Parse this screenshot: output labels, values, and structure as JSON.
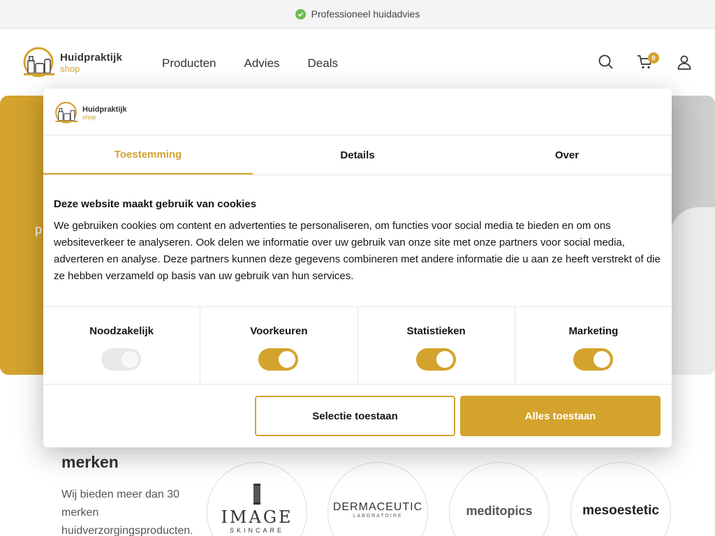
{
  "topbar": {
    "text": "Professioneel huidadvies"
  },
  "header": {
    "logo_line1": "Huidpraktijk",
    "logo_line2": "shop",
    "nav": [
      "Producten",
      "Advies",
      "Deals"
    ],
    "cart_count": "0"
  },
  "hero": {
    "partial_text": "p"
  },
  "brands": {
    "title": "merken",
    "description": "Wij bieden meer dan 30 merken huidverzorgingsproducten.",
    "items": [
      "IMAGE",
      "DERMACEUTIC",
      "meditopics",
      "mesoestetic"
    ],
    "image_sub": "SKINCARE",
    "dermaceutic_sub": "LABORATOIRE"
  },
  "cookie": {
    "logo_line1": "Huidpraktijk",
    "logo_line2": "shop",
    "tabs": [
      "Toestemming",
      "Details",
      "Over"
    ],
    "title": "Deze website maakt gebruik van cookies",
    "body": "We gebruiken cookies om content en advertenties te personaliseren, om functies voor social media te bieden en om ons websiteverkeer te analyseren. Ook delen we informatie over uw gebruik van onze site met onze partners voor social media, adverteren en analyse. Deze partners kunnen deze gegevens combineren met andere informatie die u aan ze heeft verstrekt of die ze hebben verzameld op basis van uw gebruik van hun services.",
    "categories": [
      {
        "label": "Noodzakelijk",
        "enabled": true,
        "locked": true
      },
      {
        "label": "Voorkeuren",
        "enabled": true,
        "locked": false
      },
      {
        "label": "Statistieken",
        "enabled": true,
        "locked": false
      },
      {
        "label": "Marketing",
        "enabled": true,
        "locked": false
      }
    ],
    "btn_selection": "Selectie toestaan",
    "btn_all": "Alles toestaan"
  },
  "colors": {
    "accent": "#d4a32e",
    "check": "#6dbb4f",
    "text": "#141414"
  },
  "icons": [
    "check-icon",
    "search-icon",
    "cart-icon",
    "user-icon",
    "logo-icon"
  ]
}
